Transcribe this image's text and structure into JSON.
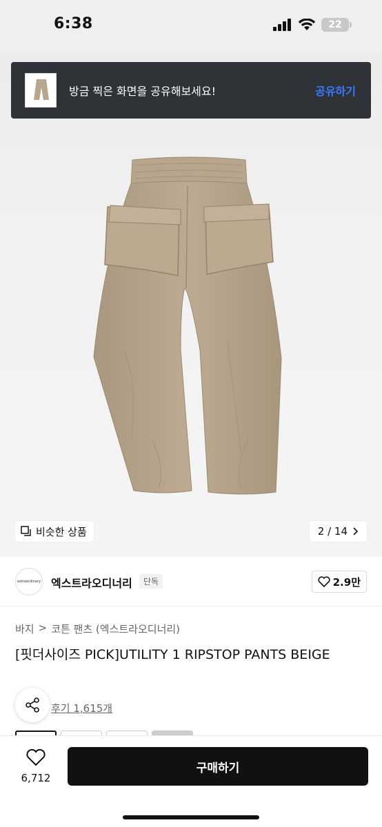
{
  "status_bar": {
    "time": "6:38",
    "battery": "22"
  },
  "toast": {
    "message": "방금 찍은 화면을 공유해보세요!",
    "action": "공유하기"
  },
  "gallery": {
    "similar_label": "비슷한 상품",
    "page_indicator": "2 / 14",
    "image_icon": "beige-pants-image"
  },
  "brand": {
    "name": "엑스트라오디너리",
    "badge": "단독",
    "like_count": "2.9만",
    "logo_text": "extraordinary"
  },
  "breadcrumb": {
    "category": "바지",
    "separator": ">",
    "subcategory": "코튼 팬츠 (엑스트라오디너리)"
  },
  "product": {
    "title": "[핏더사이즈 PICK]UTILITY 1 RIPSTOP PANTS BEIGE",
    "review_link": "후기 1,615개"
  },
  "bottom_bar": {
    "wish_count": "6,712",
    "buy_label": "구매하기"
  },
  "colors": {
    "pants": "#b8a78e",
    "buy_button": "#111111",
    "toast_bg": "#2f3236",
    "toast_action": "#3a7bff"
  }
}
